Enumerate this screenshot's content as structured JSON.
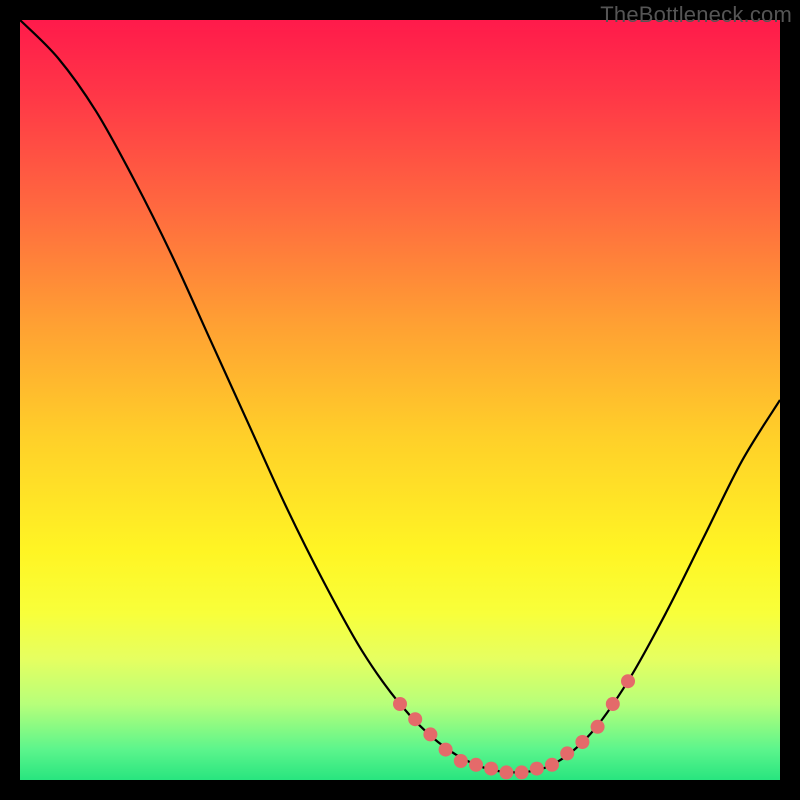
{
  "watermark": "TheBottleneck.com",
  "chart_data": {
    "type": "line",
    "title": "",
    "xlabel": "",
    "ylabel": "",
    "xlim": [
      0,
      100
    ],
    "ylim": [
      0,
      100
    ],
    "background_gradient_stops": [
      {
        "offset": 0.0,
        "color": "#ff1a4b"
      },
      {
        "offset": 0.1,
        "color": "#ff3747"
      },
      {
        "offset": 0.25,
        "color": "#ff6a3f"
      },
      {
        "offset": 0.4,
        "color": "#ffa033"
      },
      {
        "offset": 0.55,
        "color": "#ffd029"
      },
      {
        "offset": 0.7,
        "color": "#fff524"
      },
      {
        "offset": 0.78,
        "color": "#f8ff3a"
      },
      {
        "offset": 0.84,
        "color": "#e6ff60"
      },
      {
        "offset": 0.9,
        "color": "#b7ff7a"
      },
      {
        "offset": 0.96,
        "color": "#5cf58c"
      },
      {
        "offset": 1.0,
        "color": "#28e57f"
      }
    ],
    "series": [
      {
        "name": "bottleneck-curve",
        "stroke": "#000000",
        "data": [
          {
            "x": 0,
            "y": 100
          },
          {
            "x": 5,
            "y": 95
          },
          {
            "x": 10,
            "y": 88
          },
          {
            "x": 15,
            "y": 79
          },
          {
            "x": 20,
            "y": 69
          },
          {
            "x": 25,
            "y": 58
          },
          {
            "x": 30,
            "y": 47
          },
          {
            "x": 35,
            "y": 36
          },
          {
            "x": 40,
            "y": 26
          },
          {
            "x": 45,
            "y": 17
          },
          {
            "x": 50,
            "y": 10
          },
          {
            "x": 55,
            "y": 5
          },
          {
            "x": 60,
            "y": 2
          },
          {
            "x": 65,
            "y": 1
          },
          {
            "x": 70,
            "y": 2
          },
          {
            "x": 75,
            "y": 6
          },
          {
            "x": 80,
            "y": 13
          },
          {
            "x": 85,
            "y": 22
          },
          {
            "x": 90,
            "y": 32
          },
          {
            "x": 95,
            "y": 42
          },
          {
            "x": 100,
            "y": 50
          }
        ]
      }
    ],
    "markers": {
      "color": "#e46a6a",
      "radius": 7,
      "points": [
        {
          "x": 50,
          "y": 10
        },
        {
          "x": 52,
          "y": 8
        },
        {
          "x": 54,
          "y": 6
        },
        {
          "x": 56,
          "y": 4
        },
        {
          "x": 58,
          "y": 2.5
        },
        {
          "x": 60,
          "y": 2
        },
        {
          "x": 62,
          "y": 1.5
        },
        {
          "x": 64,
          "y": 1
        },
        {
          "x": 66,
          "y": 1
        },
        {
          "x": 68,
          "y": 1.5
        },
        {
          "x": 70,
          "y": 2
        },
        {
          "x": 72,
          "y": 3.5
        },
        {
          "x": 74,
          "y": 5
        },
        {
          "x": 76,
          "y": 7
        },
        {
          "x": 78,
          "y": 10
        },
        {
          "x": 80,
          "y": 13
        }
      ]
    }
  }
}
